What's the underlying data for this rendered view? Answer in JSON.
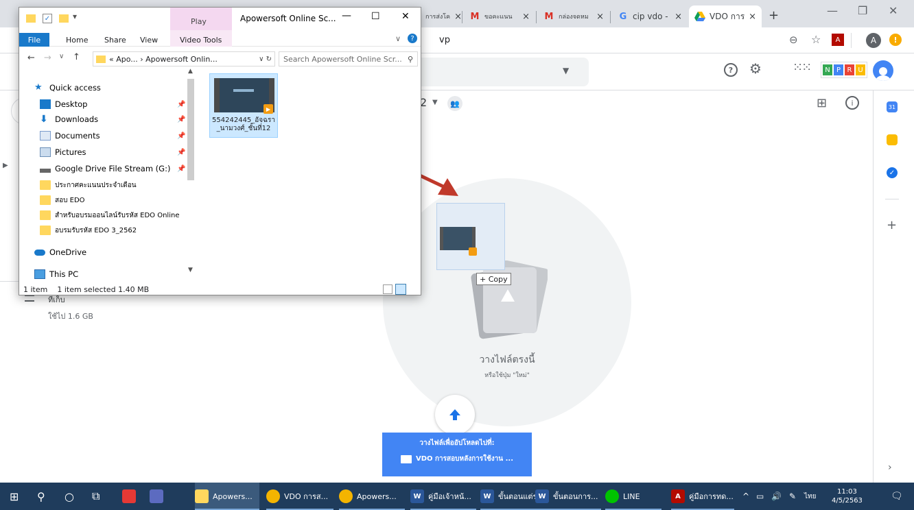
{
  "browser": {
    "tabs": [
      {
        "label": "การส่งโค",
        "icon": "doc-icon"
      },
      {
        "label": "ขอคะแนน",
        "icon": "gmail-icon"
      },
      {
        "label": "กล่องจดหม",
        "icon": "gmail-icon"
      },
      {
        "label": "cip vdo -",
        "icon": "google-icon"
      },
      {
        "label": "VDO การ",
        "icon": "drive-icon"
      }
    ],
    "new_tab": "+",
    "url_fragment": "vp",
    "avatar_letter": "A"
  },
  "drive": {
    "breadcrumb_suffix": "2",
    "storage_label": "ที่เก็บ",
    "storage_used": "ใช้ไป 1.6 GB",
    "drop_title": "วางไฟล์ตรงนี้",
    "drop_subtitle": "หรือใช้ปุ่ม \"ใหม่\"",
    "upload_banner_line1": "วางไฟล์เพื่ออัปโหลดไปที่:",
    "upload_banner_line2": "VDO การสอบหลังการใช้งาน ...",
    "drag_copy_label": "+ Copy",
    "npru": [
      "N",
      "P",
      "R",
      "U"
    ]
  },
  "explorer": {
    "title": "Apowersoft Online Sc...",
    "play_tab": "Play",
    "ribbon": {
      "file": "File",
      "home": "Home",
      "share": "Share",
      "view": "View",
      "video_tools": "Video Tools"
    },
    "address": "« Apo... › Apowersoft Onlin...",
    "search_placeholder": "Search Apowersoft Online Scr...",
    "nav": [
      {
        "label": "Quick access",
        "icon": "star-icon",
        "pinned": false
      },
      {
        "label": "Desktop",
        "icon": "desktop-icon",
        "pinned": true
      },
      {
        "label": "Downloads",
        "icon": "download-icon",
        "pinned": true
      },
      {
        "label": "Documents",
        "icon": "document-icon",
        "pinned": true
      },
      {
        "label": "Pictures",
        "icon": "pictures-icon",
        "pinned": true
      },
      {
        "label": "Google Drive File Stream (G:)",
        "icon": "drive-disk-icon",
        "pinned": true
      },
      {
        "label": "ประกาศคะแนนประจำเดือน",
        "icon": "folder-icon",
        "pinned": false
      },
      {
        "label": "สอบ EDO",
        "icon": "folder-icon",
        "pinned": false
      },
      {
        "label": "สำหรับอบรมออนไลน์รับรหัส EDO Online",
        "icon": "folder-icon",
        "pinned": false
      },
      {
        "label": "อบรมรับรหัส EDO 3_2562",
        "icon": "folder-icon",
        "pinned": false
      },
      {
        "label": "OneDrive",
        "icon": "onedrive-icon",
        "pinned": false
      },
      {
        "label": "This PC",
        "icon": "pc-icon",
        "pinned": false
      }
    ],
    "file_name_line1": "554242445_อัจฉรา",
    "file_name_line2": "_นามวงศ์_ชั้นที่12",
    "status_count": "1 item",
    "status_selected": "1 item selected  1.40 MB"
  },
  "taskbar": {
    "items": [
      {
        "label": "Apowers...",
        "icon": "folder-icon"
      },
      {
        "label": "VDO การส...",
        "icon": "chrome-icon"
      },
      {
        "label": "Apowers...",
        "icon": "chrome-icon"
      },
      {
        "label": "คู่มือเจ้าหน้...",
        "icon": "word-icon"
      },
      {
        "label": "ขั้นตอนแต่ร...",
        "icon": "word-icon"
      },
      {
        "label": "ขั้นตอนการ...",
        "icon": "word-icon"
      },
      {
        "label": "LINE",
        "icon": "line-icon"
      },
      {
        "label": "คู่มือการทด...",
        "icon": "pdf-icon"
      }
    ],
    "lang": "ไทย",
    "time": "11:03",
    "date": "4/5/2563"
  }
}
